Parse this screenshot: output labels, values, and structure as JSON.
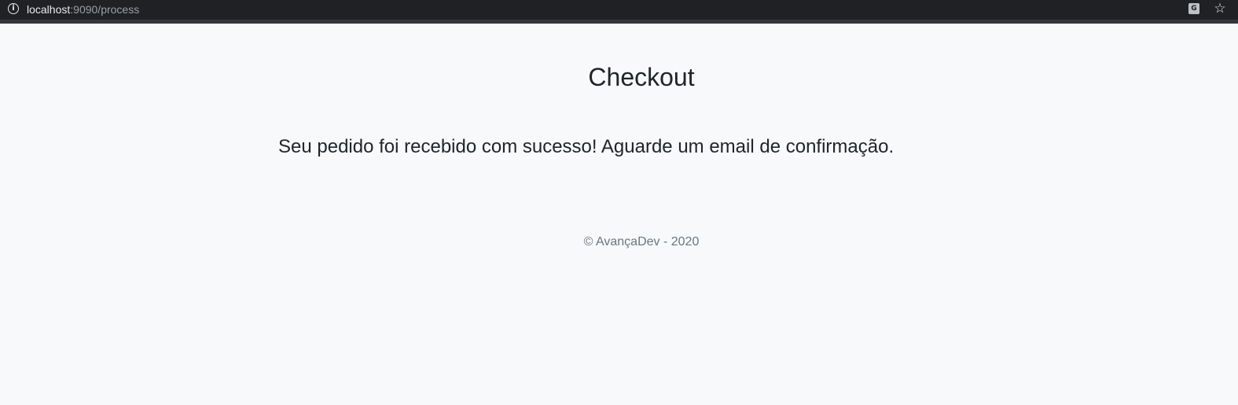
{
  "browser": {
    "url_host": "localhost",
    "url_rest": ":9090/process",
    "site_info_icon": "info-icon",
    "translate_icon": "translate-icon",
    "bookmark_icon": "star-icon"
  },
  "page": {
    "title": "Checkout",
    "message": "Seu pedido foi recebido com sucesso! Aguarde um email de confirmação.",
    "footer": "© AvançaDev - 2020"
  },
  "colors": {
    "background": "#f8f9fa",
    "text": "#212529",
    "muted": "#6c757d",
    "browser_bar": "#202124"
  }
}
